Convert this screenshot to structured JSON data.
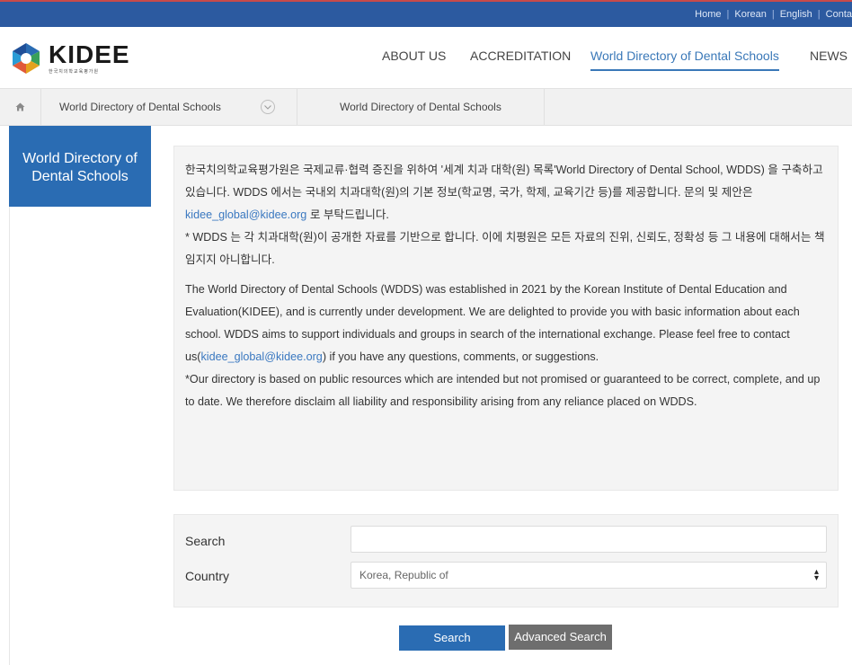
{
  "top_links": [
    "Home",
    "Korean",
    "English",
    "Conta"
  ],
  "logo": {
    "name": "KIDEE",
    "subtitle": "한국치의학교육평가원"
  },
  "nav": [
    {
      "label": "ABOUT US"
    },
    {
      "label": "ACCREDITATION"
    },
    {
      "label": "World Directory of Dental Schools",
      "active": true
    },
    {
      "label": "NEWS"
    }
  ],
  "breadcrumb": {
    "level1": "World Directory of Dental Schools",
    "level2": "World Directory of Dental Schools"
  },
  "side_title": {
    "line1": "World Directory of",
    "line2": "Dental Schools"
  },
  "intro_ko": {
    "text1": "한국치의학교육평가원은 국제교류·협력 증진을 위하여 '세계 치과 대학(원) 목록'World Directory of Dental School, WDDS) 을 구축하고 있습니다. WDDS 에서는 국내외 치과대학(원)의 기본 정보(학교명, 국가, 학제, 교육기간 등)를 제공합니다. 문의 및 제안은 ",
    "email": "kidee_global@kidee.org",
    "text2": " 로 부탁드립니다.",
    "disclaimer": "* WDDS 는 각 치과대학(원)이 공개한 자료를 기반으로 합니다. 이에 치평원은 모든 자료의 진위, 신뢰도, 정확성 등 그 내용에 대해서는 책임지지 아니합니다."
  },
  "intro_en": {
    "text1": "The World Directory of Dental Schools (WDDS) was established in 2021 by the Korean Institute of Dental Education and Evaluation(KIDEE), and is currently under development. We are delighted to provide you with basic information about each school. WDDS aims to support individuals and groups in search of the international exchange. Please feel free to contact us(",
    "email": "kidee_global@kidee.org",
    "text2": ") if you have any questions, comments, or suggestions.",
    "disclaimer": "*Our directory is based on public resources which are intended but not promised or guaranteed to be correct, complete, and up to date. We therefore disclaim all liability and responsibility arising from any reliance placed on WDDS."
  },
  "search_form": {
    "search_label": "Search",
    "search_value": "",
    "country_label": "Country",
    "country_value": "Korea, Republic of"
  },
  "buttons": {
    "search": "Search",
    "advanced": "Advanced Search"
  },
  "colors": {
    "brand_blue": "#2a6cb3",
    "top_bar": "#2c5aa0",
    "link": "#3a78c0",
    "gray_button": "#6e6e6e"
  }
}
